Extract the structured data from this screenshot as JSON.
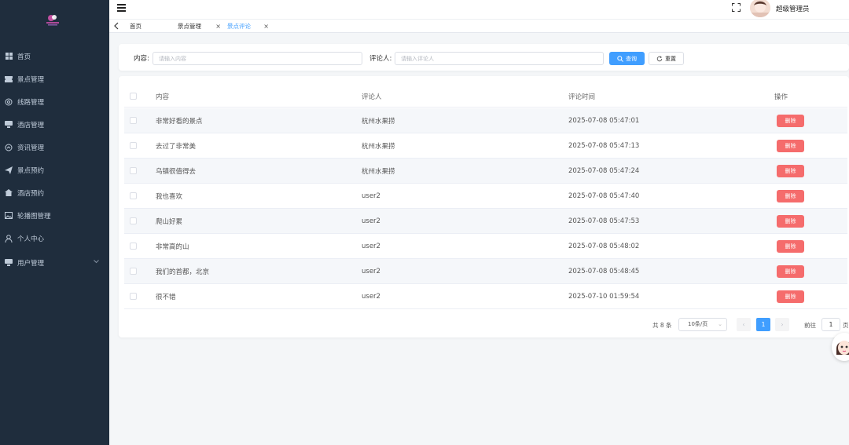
{
  "sidebar": {
    "items": [
      {
        "label": "首页",
        "icon": "dashboard-icon"
      },
      {
        "label": "景点管理",
        "icon": "ticket-icon"
      },
      {
        "label": "线路管理",
        "icon": "route-icon"
      },
      {
        "label": "酒店管理",
        "icon": "hotel-icon"
      },
      {
        "label": "资讯管理",
        "icon": "news-icon"
      },
      {
        "label": "景点预约",
        "icon": "send-icon"
      },
      {
        "label": "酒店预约",
        "icon": "home-icon"
      },
      {
        "label": "轮播图管理",
        "icon": "image-icon"
      },
      {
        "label": "个人中心",
        "icon": "user-icon"
      },
      {
        "label": "用户管理",
        "icon": "monitor-icon"
      }
    ]
  },
  "header": {
    "username": "超级管理员"
  },
  "tabs": [
    {
      "label": "首页",
      "closable": false
    },
    {
      "label": "景点管理",
      "closable": true
    },
    {
      "label": "景点评论",
      "closable": true,
      "active": true
    }
  ],
  "search": {
    "content_label": "内容:",
    "content_placeholder": "请输入内容",
    "commenter_label": "评论人:",
    "commenter_placeholder": "请输入评论人",
    "search_button": "查询",
    "reset_button": "重置"
  },
  "table": {
    "headers": [
      "内容",
      "评论人",
      "评论时间",
      "操作"
    ],
    "delete_label": "删除",
    "rows": [
      {
        "content": "非常好看的景点",
        "commenter": "杭州水果捞",
        "time": "2025-07-08 05:47:01"
      },
      {
        "content": "去过了非常美",
        "commenter": "杭州水果捞",
        "time": "2025-07-08 05:47:13"
      },
      {
        "content": "乌镇很值得去",
        "commenter": "杭州水果捞",
        "time": "2025-07-08 05:47:24"
      },
      {
        "content": "我也喜欢",
        "commenter": "user2",
        "time": "2025-07-08 05:47:40"
      },
      {
        "content": "爬山好累",
        "commenter": "user2",
        "time": "2025-07-08 05:47:53"
      },
      {
        "content": "非常高的山",
        "commenter": "user2",
        "time": "2025-07-08 05:48:02"
      },
      {
        "content": "我们的首都，北京",
        "commenter": "user2",
        "time": "2025-07-08 05:48:45"
      },
      {
        "content": "很不错",
        "commenter": "user2",
        "time": "2025-07-10 01:59:54"
      }
    ]
  },
  "pagination": {
    "total": "共 8 条",
    "page_size": "10条/页",
    "current_page": "1",
    "goto_label": "前往",
    "goto_value": "1",
    "page_suffix": "页"
  },
  "colors": {
    "sidebar_bg": "#1f2d3d",
    "primary": "#409eff",
    "danger": "#f56c6c"
  }
}
